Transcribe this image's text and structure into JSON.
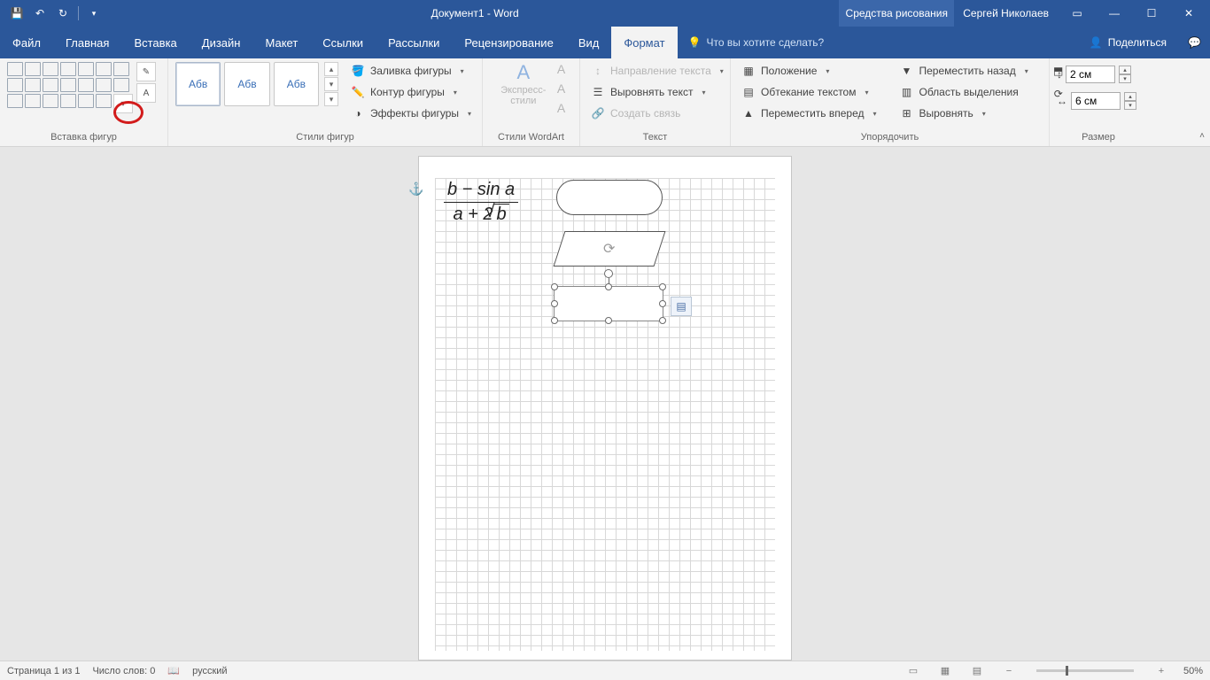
{
  "title": {
    "doc": "Документ1",
    "app": "Word",
    "tool_tab": "Средства рисования"
  },
  "user": "Сергей Николаев",
  "tabs": [
    "Файл",
    "Главная",
    "Вставка",
    "Дизайн",
    "Макет",
    "Ссылки",
    "Рассылки",
    "Рецензирование",
    "Вид",
    "Формат"
  ],
  "active_tab_index": 9,
  "tell_me": "Что вы хотите сделать?",
  "share": "Поделиться",
  "ribbon": {
    "insert_shapes": {
      "label": "Вставка фигур"
    },
    "shape_styles": {
      "label": "Стили фигур",
      "preview_text": "Абв",
      "shape_fill": "Заливка фигуры",
      "shape_outline": "Контур фигуры",
      "shape_effects": "Эффекты фигуры"
    },
    "wordart": {
      "label": "Стили WordArt",
      "quick_styles": "Экспресс-стили"
    },
    "text": {
      "label": "Текст",
      "direction": "Направление текста",
      "align": "Выровнять текст",
      "link": "Создать связь"
    },
    "arrange": {
      "label": "Упорядочить",
      "position": "Положение",
      "wrap": "Обтекание текстом",
      "forward": "Переместить вперед",
      "backward": "Переместить назад",
      "selection_pane": "Область выделения",
      "align": "Выровнять"
    },
    "size": {
      "label": "Размер",
      "height": "2 см",
      "width": "6 см"
    }
  },
  "document": {
    "formula_num": "b − sin a",
    "formula_den_prefix": "a + 2",
    "formula_sqrt": "b"
  },
  "status": {
    "page": "Страница 1 из 1",
    "words": "Число слов: 0",
    "lang": "русский",
    "zoom": "50%"
  }
}
